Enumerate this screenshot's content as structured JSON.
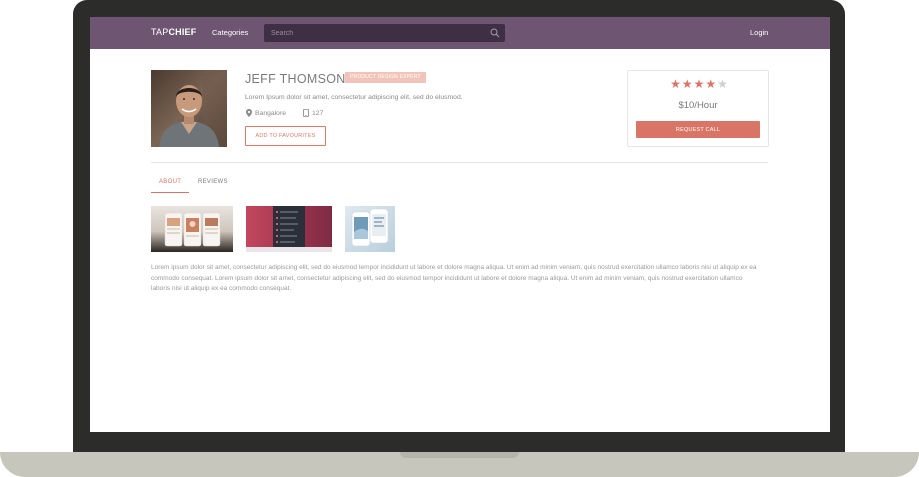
{
  "navbar": {
    "logo_light": "TAP",
    "logo_bold": "CHIEF",
    "categories_label": "Categories",
    "search_placeholder": "Search",
    "login_label": "Login"
  },
  "profile": {
    "name": "JEFF THOMSON",
    "badge": "PRODUCT DESIGN EXPERT",
    "bio": "Lorem Ipsum dolor sit amet, consectetur adipiscing elit, sed do elusmod.",
    "location": "Bangalore",
    "phone_count": "127",
    "favourite_button": "ADD TO FAVOURITES"
  },
  "pricing": {
    "rating": 4,
    "rating_max": 5,
    "price": "$10/Hour",
    "request_button": "REQUEST CALL"
  },
  "tabs": [
    {
      "label": "ABOUT",
      "active": true
    },
    {
      "label": "REVIEWS",
      "active": false
    }
  ],
  "portfolio": {
    "thumbnails": [
      "mobile-app-screens",
      "dark-menu-app-screens",
      "white-phones-screens"
    ]
  },
  "about_text": "Lorem ipsum dolor sit amet, consectetur adipiscing elit, sed do eiusmod tempor incididunt ut labore et dolore magna aliqua. Ut enim ad minim veniam, quis nostrud exercitation ullamco laboris nisi ut aliquip ex ea commodo consequat. Lorem ipsum dolor sit amet, consectetur adipiscing elit, sed do eiusmod tempor incididunt ut labore et dolore magna aliqua. Ut enim ad minim veniam, quis nostrud exercitation ullamco laboris nisi ut aliquip ex ea commodo consequat.",
  "colors": {
    "navbar": "#6e5572",
    "search_bg": "#3e2f44",
    "accent": "#d97566",
    "badge": "#f2c4b9",
    "laptop_bezel": "#2c2c2a",
    "laptop_base": "#c6c6bd"
  }
}
